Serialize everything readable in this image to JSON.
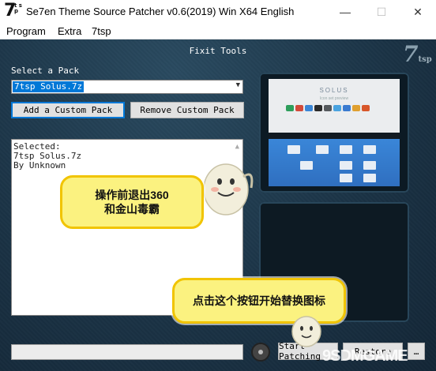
{
  "window": {
    "title": "Se7en Theme Source Patcher v0.6(2019) Win X64 English",
    "logo_big": "7",
    "logo_small": "t s p",
    "minimize": "—",
    "maximize": "☐",
    "close": "✕"
  },
  "menu": {
    "items": [
      "Program",
      "Extra",
      "7tsp"
    ]
  },
  "main": {
    "section_title": "Fixit Tools",
    "brand": "7",
    "brand_small": "tsp",
    "select_label": "Select a Pack",
    "selected_pack": "7tsp Solus.7z",
    "add_button": "Add a Custom Pack",
    "remove_button": "Remove Custom Pack",
    "info_lines": [
      "Selected:",
      "7tsp Solus.7z",
      "By Unknown"
    ],
    "preview_title": "SOLUS",
    "preview_subtitle": "Icon set preview"
  },
  "footer": {
    "path_value": "",
    "patch_button": "Start Patching",
    "restore_button": "Restore",
    "extra_button": "…"
  },
  "annotations": {
    "bubble1": "操作前退出360\n和金山毒霸",
    "bubble2": "点击这个按钮开始替换图标",
    "watermark": "9SDMGAME"
  },
  "colors": {
    "background": "#1b3346",
    "accent": "#0078d7",
    "bubble_fill": "#fbf280",
    "bubble_border": "#f1c400"
  }
}
